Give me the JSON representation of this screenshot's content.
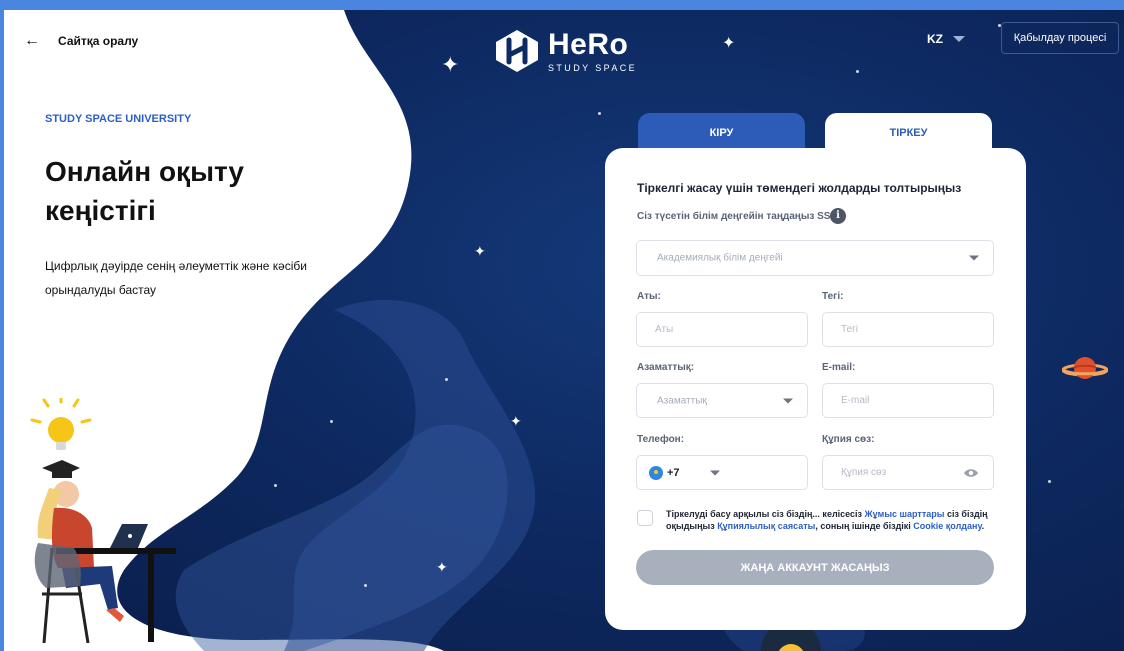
{
  "header": {
    "back_label": "Сайтқа оралу",
    "logo_name": "HeRo",
    "logo_subtitle": "STUDY SPACE",
    "language": "KZ",
    "admission_label": "Қабылдау процесі"
  },
  "hero": {
    "university": "STUDY SPACE UNIVERSITY",
    "title": "Онлайн оқыту кеңістігі",
    "description": "Цифрлық дәуірде сенің әлеуметтік және кәсіби орындалуды бастау"
  },
  "tabs": [
    {
      "label": "КІРУ",
      "active": false
    },
    {
      "label": "ТІРКЕУ",
      "active": true
    }
  ],
  "form": {
    "title": "Тіркелгі жасау үшін төмендегі жолдарды толтырыңыз",
    "level_label": "Сіз түсетін білім деңгейін таңдаңыз SSU",
    "level_placeholder": "Академиялық білім деңгейі",
    "first_name_label": "Аты:",
    "first_name_placeholder": "Аты",
    "last_name_label": "Тегі:",
    "last_name_placeholder": "Тегі",
    "citizenship_label": "Азаматтық:",
    "citizenship_placeholder": "Азаматтық",
    "email_label": "E-mail:",
    "email_placeholder": "E-mail",
    "phone_label": "Телефон:",
    "phone_code": "+7",
    "password_label": "Құпия сөз:",
    "password_placeholder": "Құпия сөз",
    "consent": {
      "part1": "Тіркелуді басу арқылы сіз біздің... келісесіз ",
      "link1": "Жұмыс шарттары",
      "part2": " сіз біздің оқыдыңыз ",
      "link2": "Құпиялылық саясаты",
      "part3": ", соның ішінде біздікі ",
      "link3": "Cookie қолдану",
      "part4": "."
    },
    "submit_label": "ЖАҢА АККАУНТ ЖАСАҢЫЗ"
  },
  "icons": {
    "back": "arrow-left-icon",
    "info": "info-icon",
    "eye": "eye-icon",
    "flag": "kz-flag-icon",
    "planet": "planet-icon"
  },
  "colors": {
    "accent": "#2c5cb8",
    "background": "#0e2a62",
    "submit_disabled": "#a8afbd"
  }
}
